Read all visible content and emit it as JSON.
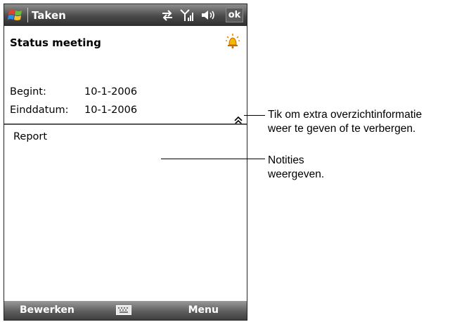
{
  "titlebar": {
    "app_title": "Taken",
    "ok_label": "ok"
  },
  "task": {
    "title": "Status meeting",
    "start_label": "Begint:",
    "start_value": "10-1-2006",
    "end_label": "Einddatum:",
    "end_value": "10-1-2006"
  },
  "notes": {
    "text": "Report"
  },
  "menubar": {
    "left_label": "Bewerken",
    "right_label": "Menu"
  },
  "callouts": {
    "summary_line1": "Tik om extra overzichtinformatie",
    "summary_line2": "weer te geven of te verbergen.",
    "notes_line1": "Notities",
    "notes_line2": "weergeven."
  },
  "icons": {
    "start": "windows-logo-icon",
    "sync": "sync-arrows-icon",
    "signal": "signal-strength-icon",
    "volume": "volume-icon",
    "alarm": "alarm-bell-icon",
    "collapse": "collapse-chevron-icon",
    "keyboard": "keyboard-icon"
  }
}
